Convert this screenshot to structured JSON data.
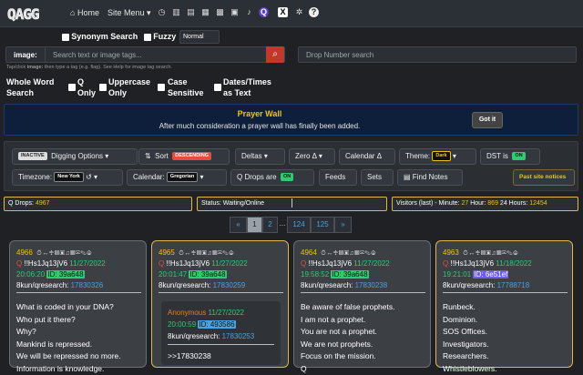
{
  "nav": {
    "logo": "QAGG",
    "home": "Home",
    "site_menu": "Site Menu",
    "icons": [
      "home-icon",
      "clock-icon",
      "chart-icon",
      "bookmarks-icon",
      "film-icon",
      "grid-icon",
      "bell-icon",
      "q-icon",
      "x-icon",
      "gear-icon",
      "help-icon"
    ]
  },
  "search": {
    "synonym_label": "Synonym Search",
    "fuzzy_label": "Fuzzy",
    "fuzzy_value": "Normal",
    "image_label": "image:",
    "image_placeholder": "Search text or image tags...",
    "drop_placeholder": "Drop Number search",
    "hint_bold": "Tap/click",
    "hint_image": "image:",
    "hint_rest": "then type a tag (e.g. flag). See Help for image tag search."
  },
  "options": [
    "Whole Word Search",
    "Q Only",
    "Uppercase Only",
    "Case Sensitive",
    "Dates/Times as Text"
  ],
  "options_lines": [
    [
      "Whole Word",
      "Search"
    ],
    [
      "Q",
      "Only"
    ],
    [
      "Uppercase",
      "Only"
    ],
    [
      "Case",
      "Sensitive"
    ],
    [
      "Dates/Times",
      "as Text"
    ]
  ],
  "prayer": {
    "title": "Prayer Wall",
    "subtitle": "After much consideration a prayer wall has finally been added.",
    "button": "Got it"
  },
  "toolbar": {
    "inactive": "INACTIVE",
    "digging": "Digging Options",
    "sort": "Sort",
    "sort_tag": "DESCENDING",
    "deltas": "Deltas",
    "zero": "Zero Δ",
    "calendar_delta": "Calendar Δ",
    "theme": "Theme:",
    "theme_tag": "Dark",
    "dst": "DST is",
    "dst_tag": "ON",
    "timezone": "Timezone:",
    "tz_value": "New York",
    "calendar": "Calendar:",
    "cal_value": "Gregorian",
    "qdrops": "Q Drops are",
    "qdrops_tag": "ON",
    "feeds": "Feeds",
    "sets": "Sets",
    "find_notes": "Find Notes",
    "past": "Past site notices"
  },
  "status": {
    "q_drops_label": "Q Drops:",
    "q_drops": "4967",
    "status": "Status: Waiting/Online",
    "visitors_label": "Visitors (last) - Minute:",
    "minute": "27",
    "hour_label": "Hour:",
    "hour": "869",
    "day_label": "24 Hours:",
    "day": "12454"
  },
  "pagination": [
    "«",
    "1",
    "2",
    "...",
    "124",
    "125",
    "»"
  ],
  "cards": [
    {
      "num": "4966",
      "name": "Q",
      "trip": "!!Hs1Jq13jV6",
      "date": "11/27/2022",
      "time": "20:06:20",
      "id": "ID: 39a648",
      "board": "8kun/qresearch:",
      "post": "17830326",
      "lines": [
        "What is coded in your DNA?",
        "Who put it there?",
        "Why?",
        "Mankind is repressed.",
        "We will be repressed no more.",
        "Information is knowledge."
      ]
    },
    {
      "num": "4965",
      "name": "Q",
      "trip": "!!Hs1Jq13jV6",
      "date": "11/27/2022",
      "time": "20:01:47",
      "id": "ID: 39a648",
      "board": "8kun/qresearch:",
      "post": "17830259",
      "ref_name": "Anonymous",
      "ref_date": "11/27/2022",
      "ref_time": "20:00:59",
      "ref_id": "ID: 493586",
      "ref_board": "8kun/qresearch:",
      "ref_post": "17830253",
      "ref_text": ">>17830238"
    },
    {
      "num": "4964",
      "name": "Q",
      "trip": "!!Hs1Jq13jV6",
      "date": "11/27/2022",
      "time": "19:58:52",
      "id": "ID: 39a648",
      "board": "8kun/qresearch:",
      "post": "17830238",
      "lines": [
        "Be aware of false prophets.",
        "I am not a prophet.",
        "You are not a prophet.",
        "We are not prophets.",
        "Focus on the mission.",
        "Q"
      ]
    },
    {
      "num": "4963",
      "name": "Q",
      "trip": "!!Hs1Jq13jV6",
      "date": "11/18/2022",
      "time": "19:21:01",
      "id": "ID: 6e51ef",
      "board": "8kun/qresearch:",
      "post": "17788718",
      "lines": [
        "Runbeck.",
        "Dominion.",
        "SOS Offices.",
        "Investigators.",
        "Researchers.",
        "Whistleblowers."
      ]
    }
  ],
  "colors": {
    "accent": "#f1c40f",
    "link": "#4aa3df",
    "red": "#e74c3c",
    "green": "#2ecc71",
    "prayer_bg": "#0e1f3c"
  }
}
